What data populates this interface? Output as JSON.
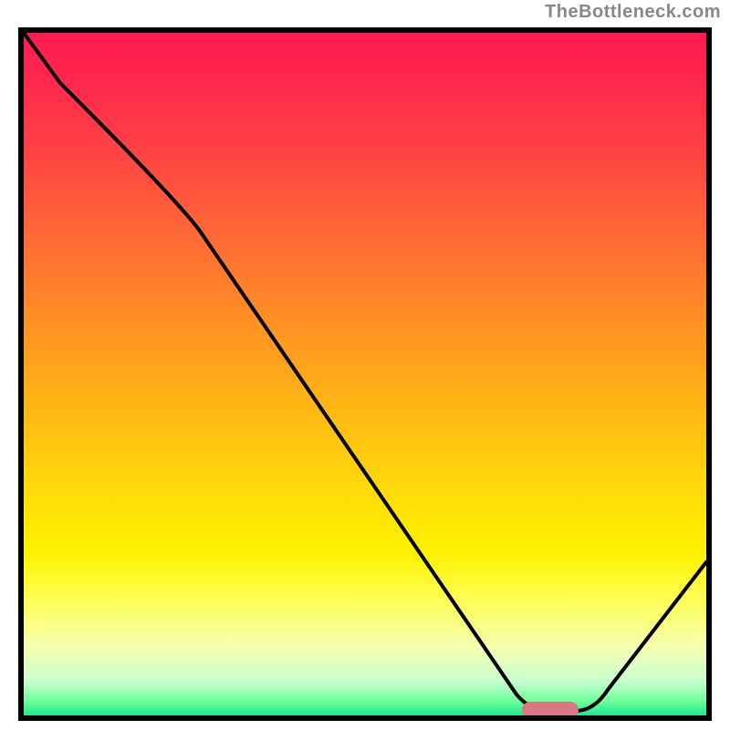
{
  "watermark": "TheBottleneck.com",
  "chart_data": {
    "type": "line",
    "title": "",
    "xlabel": "",
    "ylabel": "",
    "xlim": [
      0,
      100
    ],
    "ylim": [
      0,
      100
    ],
    "series": [
      {
        "name": "curve",
        "x": [
          0,
          25,
          75,
          80,
          100
        ],
        "y": [
          100,
          75,
          0,
          0,
          20
        ]
      }
    ],
    "marker": {
      "x_start": 73,
      "x_end": 81,
      "y": 0
    }
  },
  "colors": {
    "gradient_top": "#ff1a51",
    "gradient_mid": "#ffd80b",
    "gradient_bottom": "#1de88e",
    "curve": "#000000",
    "marker": "#d97784",
    "border": "#000000"
  }
}
